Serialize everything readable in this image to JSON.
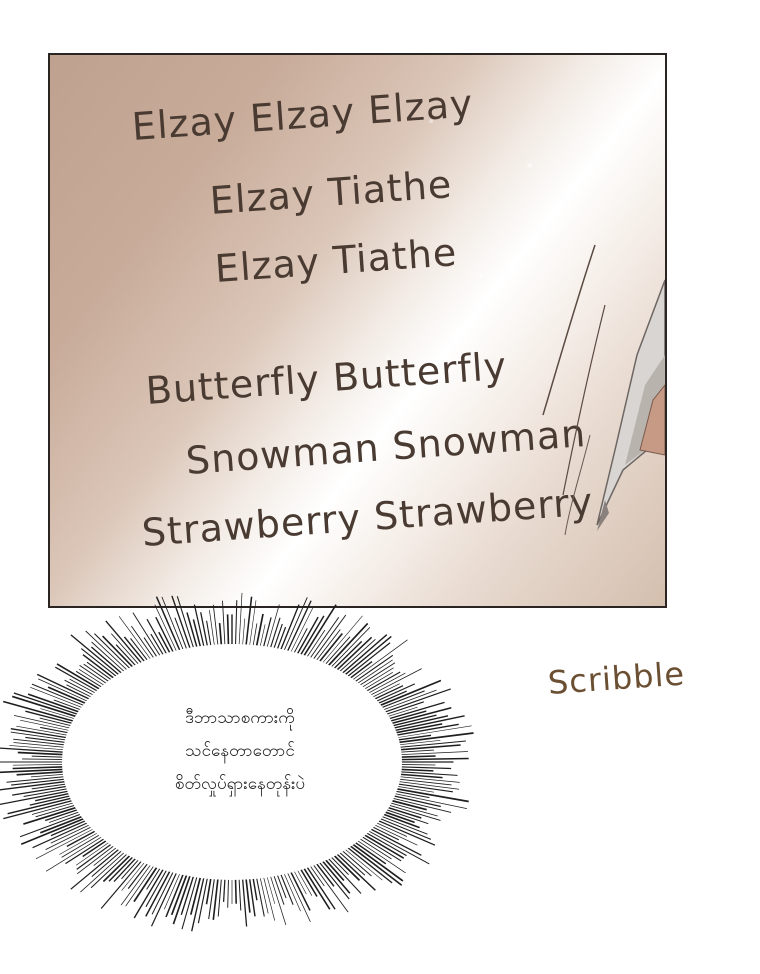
{
  "panel": {
    "handwriting_lines": [
      "Elzay Elzay Elzay",
      "Elzay Tiathe",
      "Elzay Tiathe",
      "Butterfly Butterfly",
      "Snowman Snowman",
      "Strawberry Strawberry"
    ]
  },
  "speech_bubble": {
    "lines": [
      "ဒီဘာသာစကားကို",
      "သင်နေတာတောင်",
      "စိတ်လှုပ်ရှားနေတုန်းပဲ"
    ]
  },
  "sound_effect": {
    "text": "Scribble"
  },
  "colors": {
    "panel_border": "#2a2522",
    "handwriting": "#4a3b32",
    "sfx": "#6b4f32",
    "bubble_text": "#1b1b1b",
    "pen_sleeve": "#c79a86"
  }
}
